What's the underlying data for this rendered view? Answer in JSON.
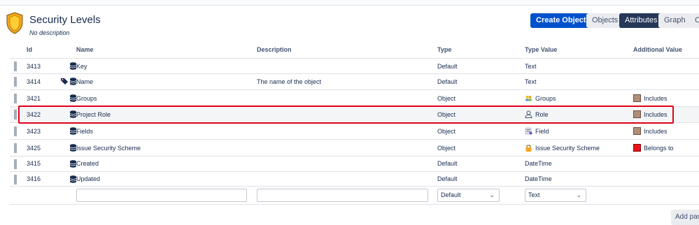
{
  "header": {
    "title": "Security Levels",
    "subtitle": "No description",
    "buttons": {
      "create": "Create Object",
      "objects": "Objects",
      "attributes": "Attributes",
      "graph": "Graph",
      "more": "C"
    }
  },
  "columns": {
    "id": "Id",
    "name": "Name",
    "description": "Description",
    "type": "Type",
    "type_value": "Type Value",
    "additional_value": "Additional Value"
  },
  "rows": [
    {
      "id": "3413",
      "name": "Key",
      "description": "",
      "type": "Default",
      "type_value": "Text",
      "additional": ""
    },
    {
      "id": "3414",
      "name": "Name",
      "description": "The name of the object",
      "type": "Default",
      "type_value": "Text",
      "additional": ""
    },
    {
      "id": "3421",
      "name": "Groups",
      "description": "",
      "type": "Object",
      "type_value": "Groups",
      "additional": "Includes"
    },
    {
      "id": "3422",
      "name": "Project Role",
      "description": "",
      "type": "Object",
      "type_value": "Role",
      "additional": "Includes"
    },
    {
      "id": "3423",
      "name": "Fields",
      "description": "",
      "type": "Object",
      "type_value": "Field",
      "additional": "Includes"
    },
    {
      "id": "3425",
      "name": "Issue Security Scheme",
      "description": "",
      "type": "Object",
      "type_value": "Issue Security Scheme",
      "additional": "Belongs to"
    },
    {
      "id": "3415",
      "name": "Created",
      "description": "",
      "type": "Default",
      "type_value": "DateTime",
      "additional": ""
    },
    {
      "id": "3416",
      "name": "Updated",
      "description": "",
      "type": "Default",
      "type_value": "DateTime",
      "additional": ""
    }
  ],
  "new_row": {
    "type_select": "Default",
    "type_value_select": "Text"
  },
  "add_button": "Add par",
  "colors": {
    "primary": "#0052cc",
    "active_tab": "#253858",
    "includes_swatch": "#b08f7a",
    "belongs_swatch": "#e8131a",
    "highlight": "#e0001a"
  }
}
